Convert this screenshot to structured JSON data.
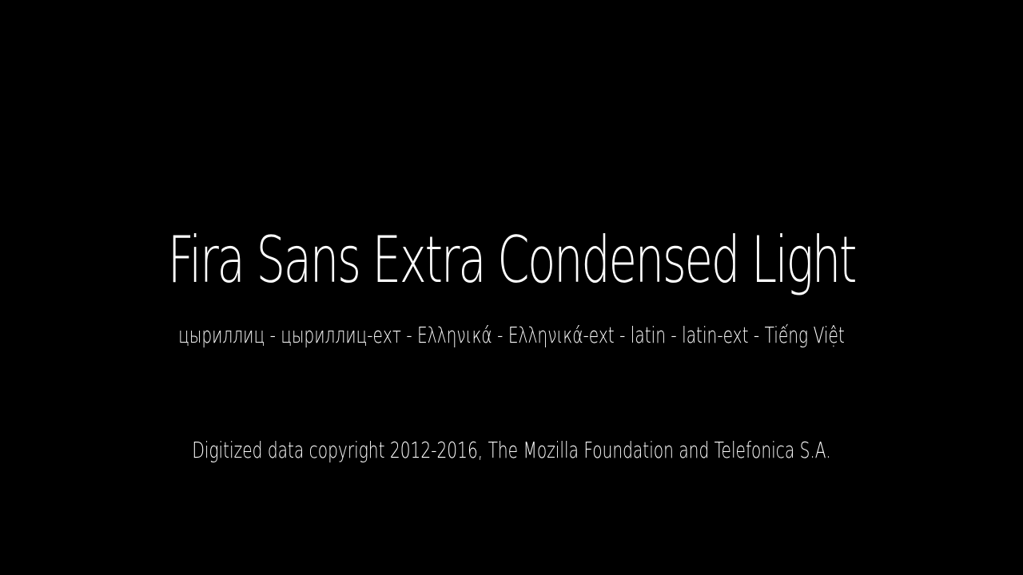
{
  "background_color": "#000000",
  "text_color": "#ffffff",
  "font_preview": {
    "title": "Fira Sans Extra Condensed Light",
    "scripts": "цыриллиц - цыриллиц-ехт - Ελληνικά - Ελληνικά-ext - latin - latin-ext - Tiếng Việt",
    "copyright": "Digitized data copyright 2012-2016, The Mozilla Foundation and Telefonica S.A."
  }
}
